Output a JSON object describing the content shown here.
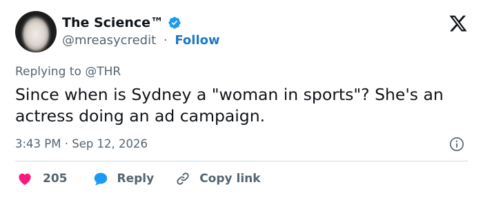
{
  "author": {
    "display_name": "The Science™",
    "handle": "@mreasycredit",
    "separator": "·",
    "follow_label": "Follow"
  },
  "reply_context": "Replying to @THR",
  "tweet": {
    "text": "Since when is Sydney a \"woman in sports\"? She's an actress doing an ad campaign.",
    "timestamp": "3:43 PM · Sep 12, 2026"
  },
  "actions": {
    "like_count": "205",
    "reply_label": "Reply",
    "copy_label": "Copy link"
  },
  "colors": {
    "like": "#f91880",
    "reply": "#1d9bf0",
    "verified": "#1d9bf0",
    "follow": "#1d78c8"
  }
}
